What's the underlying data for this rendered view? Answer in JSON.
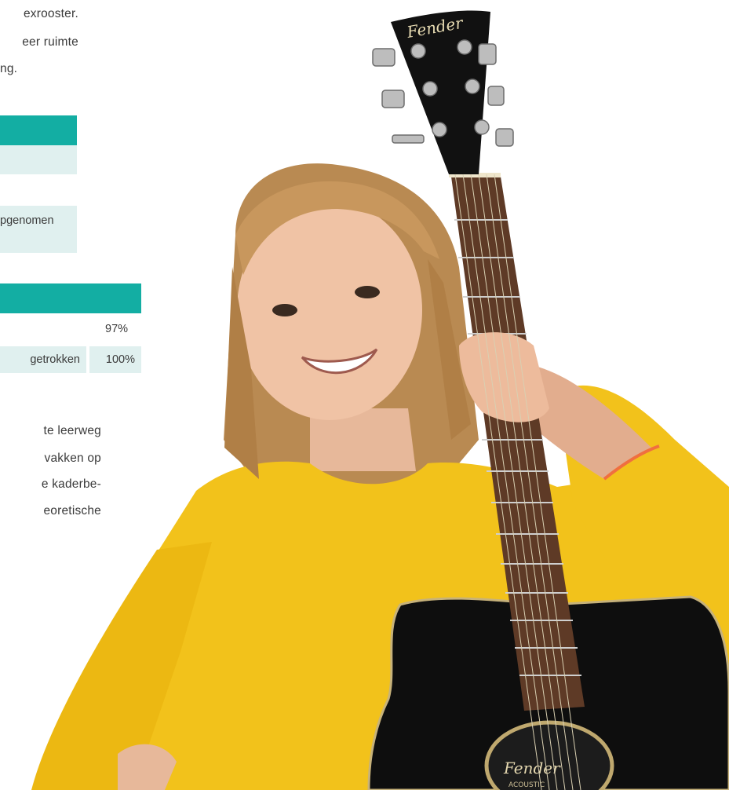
{
  "intro": {
    "line1": "exrooster.",
    "line2": "eer ruimte",
    "line3": "ng."
  },
  "table1": {
    "row2_text": "pgenomen"
  },
  "table2": {
    "row1_value": "97%",
    "row2_text": "getrokken",
    "row2_value": "100%"
  },
  "body2": {
    "line1": "te leerweg",
    "line2": "vakken op",
    "line3": "e kaderbe-",
    "line4": "eoretische"
  },
  "photo": {
    "brand_text": "Fender",
    "brand_soundhole": "Fender",
    "soundhole_sub": "ACOUSTIC"
  },
  "colors": {
    "accent": "#13aea3",
    "accent_light": "#e0f0ef",
    "shirt": "#f2c21b",
    "hair": "#b98a52",
    "guitar_body": "#0e0e0e"
  }
}
